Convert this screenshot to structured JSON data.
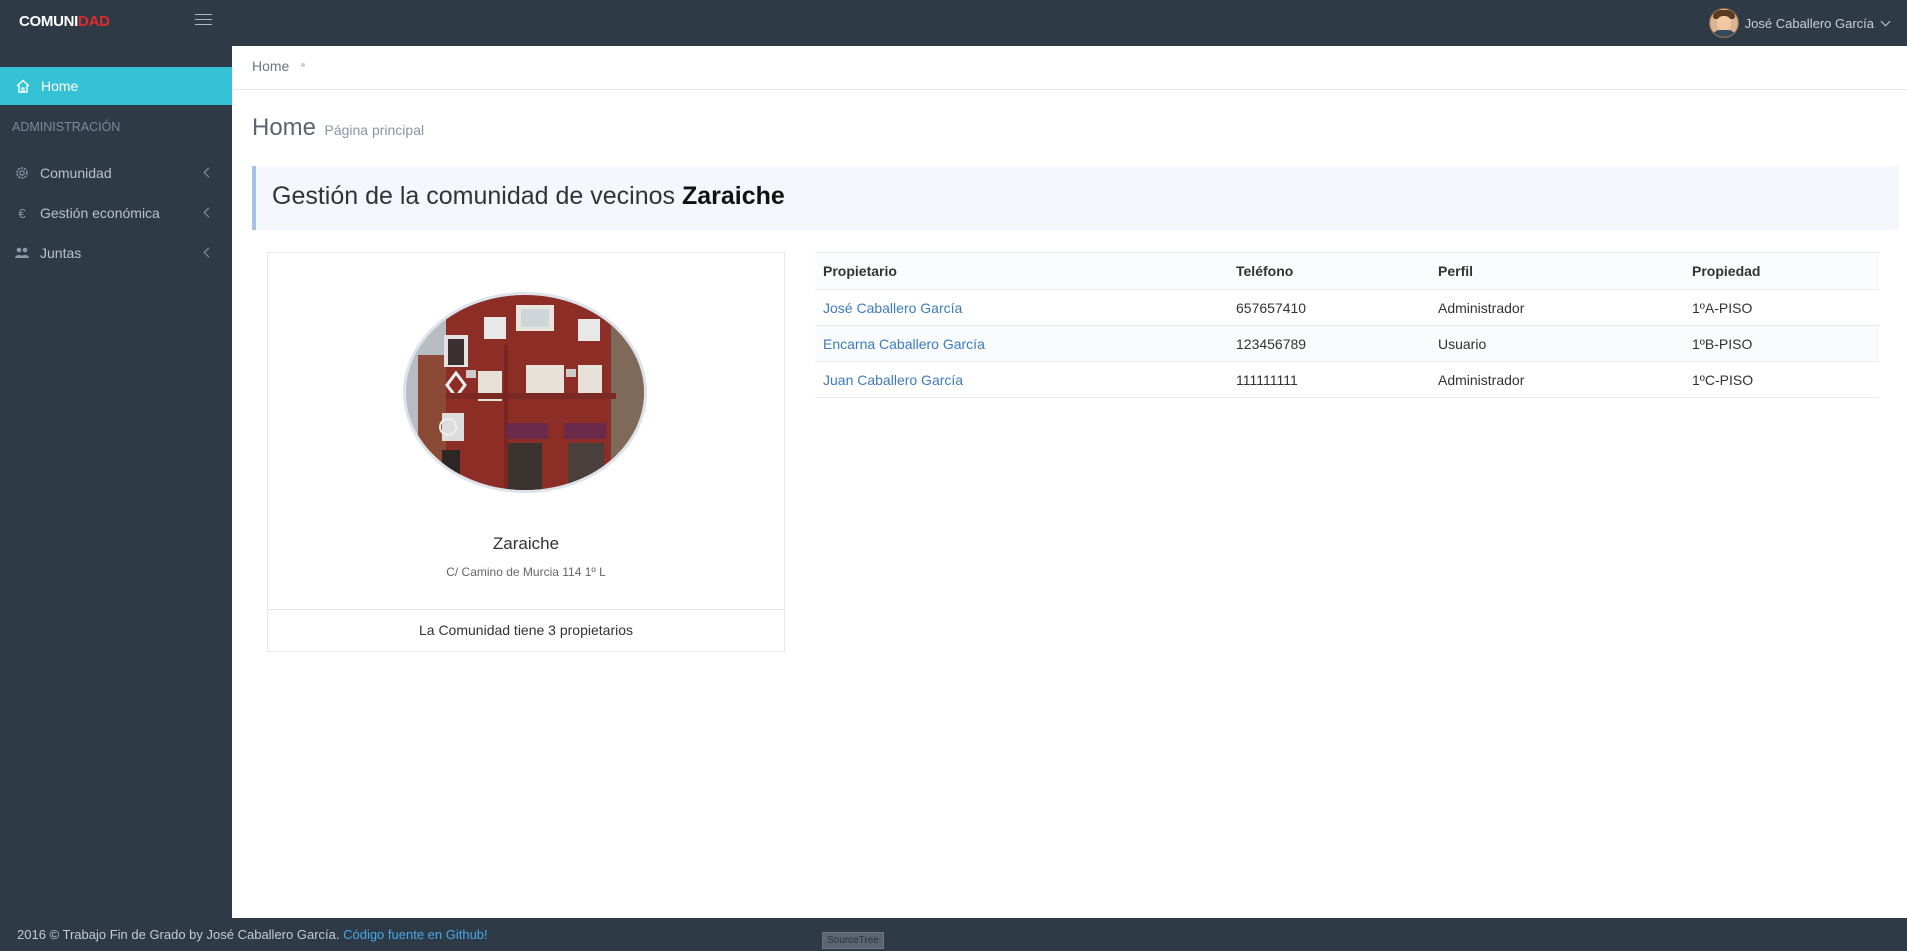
{
  "app": {
    "logo_part1": "COMUNI",
    "logo_part2": "DAD",
    "brand_color": "#e02a2a",
    "accent_color": "#35c2d5"
  },
  "topbar": {
    "user_name": "José Caballero García"
  },
  "sidebar": {
    "home_label": "Home",
    "section_header": "ADMINISTRACIÓN",
    "items": [
      {
        "label": "Comunidad",
        "icon": "gear-icon"
      },
      {
        "label": "Gestión económica",
        "icon": "euro-icon"
      },
      {
        "label": "Juntas",
        "icon": "users-icon"
      }
    ]
  },
  "breadcrumb": {
    "home": "Home"
  },
  "page": {
    "title": "Home",
    "subtitle": "Página principal"
  },
  "callout": {
    "text": "Gestión de la comunidad de vecinos ",
    "name": "Zaraiche"
  },
  "card": {
    "name": "Zaraiche",
    "address": "C/ Camino de Murcia 114 1º L",
    "footer": "La Comunidad tiene 3 propietarios"
  },
  "table": {
    "headers": [
      "Propietario",
      "Teléfono",
      "Perfil",
      "Propiedad"
    ],
    "rows": [
      {
        "owner": "José Caballero García",
        "phone": "657657410",
        "profile": "Administrador",
        "property": "1ºA-PISO"
      },
      {
        "owner": "Encarna Caballero García",
        "phone": "123456789",
        "profile": "Usuario",
        "property": "1ºB-PISO"
      },
      {
        "owner": "Juan Caballero García",
        "phone": "111111111",
        "profile": "Administrador",
        "property": "1ºC-PISO"
      }
    ]
  },
  "footer": {
    "text": "2016 © Trabajo Fin de Grado by José Caballero García. ",
    "link": "Código fuente en Github!",
    "overlay": "SourceTree"
  }
}
